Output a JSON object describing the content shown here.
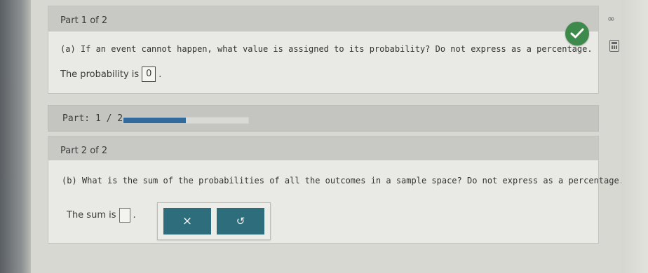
{
  "part1": {
    "header": "Part 1 of 2",
    "question": "(a) If an event cannot happen, what value is assigned to its probability? Do not express as a percentage.",
    "answer_prefix": "The probability is",
    "answer_value": "0",
    "answer_suffix": ".",
    "status": "correct"
  },
  "progress": {
    "label": "Part: 1 / 2",
    "fraction": 0.5,
    "color": "#336a9c"
  },
  "part2": {
    "header": "Part 2 of 2",
    "question": "(b) What is the sum of the probabilities of all the outcomes in a sample space? Do not express as a percentage.",
    "answer_prefix": "The sum is",
    "answer_value": "",
    "answer_suffix": ".",
    "clear_symbol": "×",
    "undo_symbol": "↺"
  },
  "side_tools": {
    "infinity_symbol": "∞",
    "calculator_icon": "calculator-icon"
  },
  "colors": {
    "button": "#2d6d7c",
    "check": "#3d8a4c"
  }
}
